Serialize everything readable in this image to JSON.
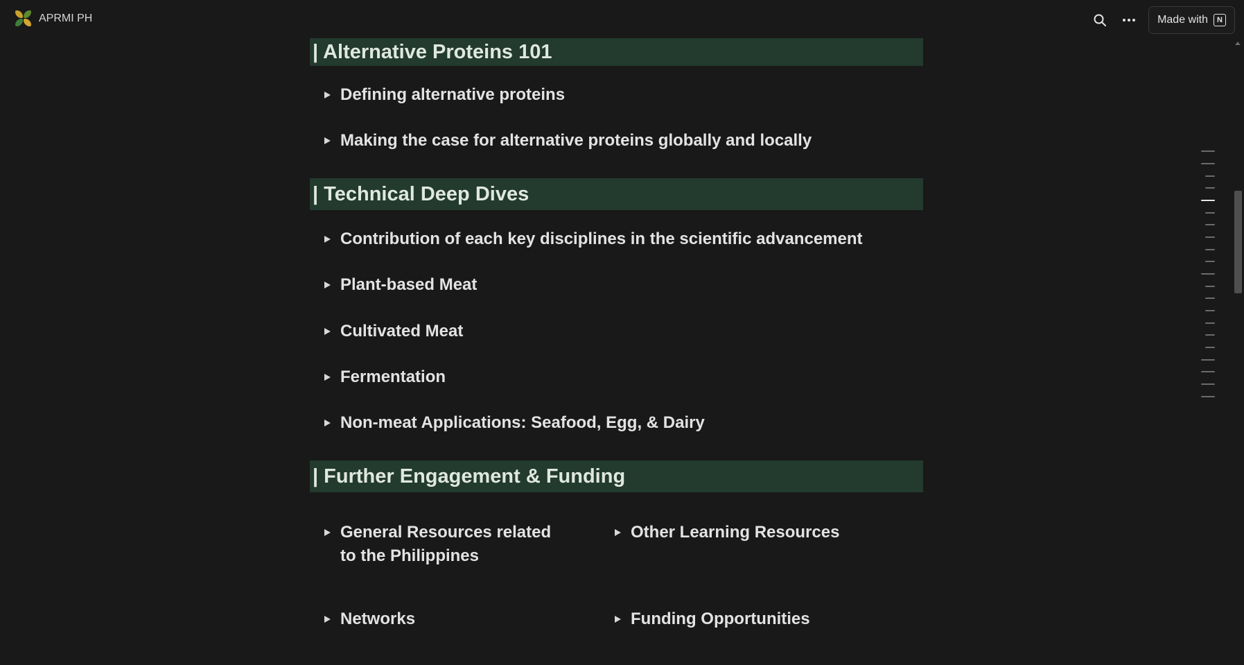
{
  "brand": {
    "name": "APRMI PH",
    "logo_icon": "aprmi-logo-icon"
  },
  "top_actions": {
    "search_icon": "search-icon",
    "more_icon": "more-horizontal-icon",
    "made_with_label": "Made with",
    "notion_icon_glyph": "N"
  },
  "sections": [
    {
      "title": "| Alternative Proteins 101"
    },
    {
      "title": "| Technical Deep Dives"
    },
    {
      "title": "| Further Engagement & Funding"
    }
  ],
  "toggles": {
    "alt_proteins": [
      "Defining alternative proteins",
      "Making the case for alternative proteins globally and locally"
    ],
    "deep_dives": [
      "Contribution of each key disciplines in the scientific advancement",
      "Plant-based Meat",
      "Cultivated Meat",
      "Fermentation",
      "Non-meat Applications: Seafood, Egg, & Dairy"
    ],
    "engagement": {
      "general_resources_line1": "General Resources related",
      "general_resources_line2": "to the Philippines",
      "other_learning": "Other Learning Resources",
      "networks": "Networks",
      "funding": "Funding Opportunities"
    }
  },
  "colors": {
    "background": "#191919",
    "section_header_bg": "#233a2e",
    "text": "#e3e3e3"
  }
}
